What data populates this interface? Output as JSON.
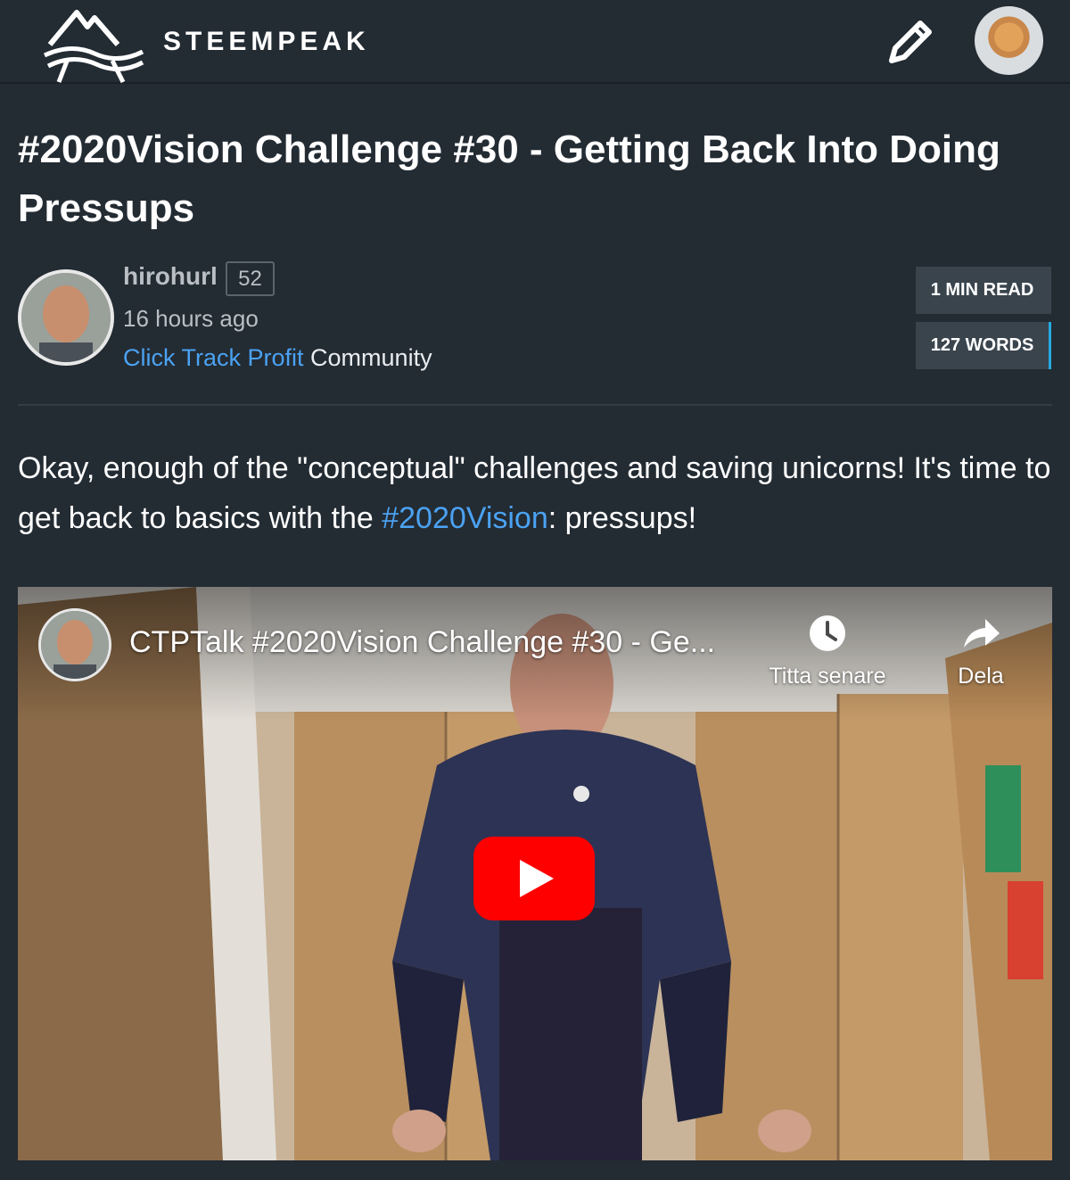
{
  "header": {
    "brand": "STEEMPEAK",
    "logo_icon": "mountain-waves-logo",
    "compose_icon": "pencil-icon",
    "avatar_icon": "kitten-avatar"
  },
  "post": {
    "title": "#2020Vision Challenge #30 - Getting Back Into Doing Pressups",
    "author": {
      "name": "hirohurl",
      "reputation": "52",
      "time_ago": "16 hours ago",
      "community_link": "Click Track Profit",
      "community_suffix": "Community"
    },
    "stats": {
      "read_time": "1 MIN READ",
      "word_count": "127 WORDS"
    },
    "intro": {
      "before": "Okay, enough of the \"conceptual\" challenges and saving unicorns! It's time to get back to basics with the ",
      "hashtag": "#2020Vision",
      "after": ": pressups!"
    }
  },
  "video": {
    "title": "CTPTalk #2020Vision Challenge #30 - Ge...",
    "watch_later_label": "Titta senare",
    "share_label": "Dela",
    "colors": {
      "play": "#ff0000"
    }
  }
}
